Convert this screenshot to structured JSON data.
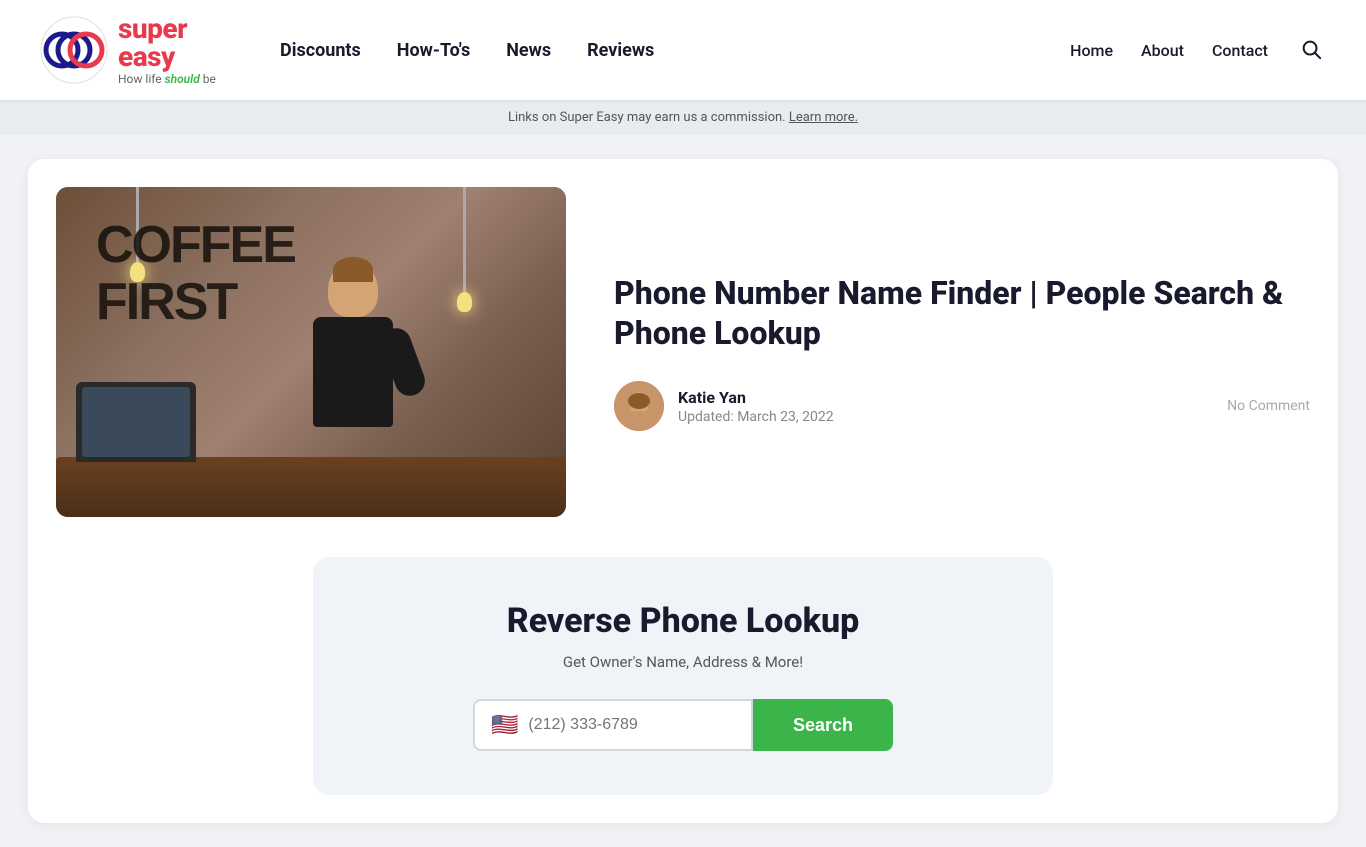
{
  "header": {
    "logo": {
      "brand_pre": "super",
      "brand_post": "easy",
      "tagline_pre": "How life ",
      "tagline_em": "should",
      "tagline_post": " be"
    },
    "nav_main": [
      {
        "label": "Discounts",
        "href": "#"
      },
      {
        "label": "How-To's",
        "href": "#"
      },
      {
        "label": "News",
        "href": "#"
      },
      {
        "label": "Reviews",
        "href": "#"
      }
    ],
    "nav_right": [
      {
        "label": "Home",
        "href": "#"
      },
      {
        "label": "About",
        "href": "#"
      },
      {
        "label": "Contact",
        "href": "#"
      }
    ]
  },
  "affiliate_bar": {
    "text": "Links on Super Easy may earn us a commission.",
    "learn_more": "Learn more."
  },
  "article": {
    "title": "Phone Number Name Finder | People Search & Phone Lookup",
    "author_name": "Katie Yan",
    "updated_label": "Updated: March 23, 2022",
    "no_comment": "No Comment"
  },
  "lookup_widget": {
    "title": "Reverse Phone Lookup",
    "subtitle": "Get Owner's Name, Address & More!",
    "phone_placeholder": "(212) 333-6789",
    "search_label": "Search"
  }
}
